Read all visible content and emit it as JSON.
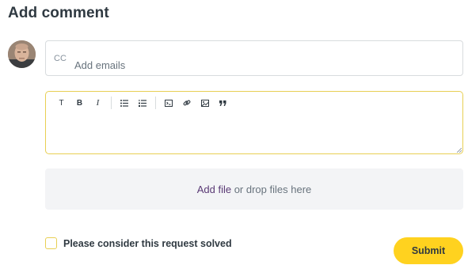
{
  "heading": "Add comment",
  "cc": {
    "label": "CC",
    "placeholder": "Add emails"
  },
  "editor": {
    "toolbar": [
      {
        "name": "text-format",
        "glyph": "T"
      },
      {
        "name": "bold",
        "glyph": "B"
      },
      {
        "name": "italic",
        "glyph": "I"
      },
      {
        "name": "bulleted-list",
        "icon": "bulleted-list-icon"
      },
      {
        "name": "numbered-list",
        "icon": "numbered-list-icon"
      },
      {
        "name": "code-block",
        "icon": "code-block-icon"
      },
      {
        "name": "link",
        "icon": "link-icon"
      },
      {
        "name": "image",
        "icon": "image-icon"
      },
      {
        "name": "quote",
        "icon": "quote-icon"
      }
    ],
    "value": ""
  },
  "attachments": {
    "link_text": "Add file",
    "rest_text": " or drop files here"
  },
  "solved": {
    "label": "Please consider this request solved",
    "checked": false
  },
  "submit_label": "Submit",
  "colors": {
    "accent": "#ffd21f",
    "focus_border": "#e8cf53",
    "link": "#5a3a75",
    "dropzone_bg": "#f3f4f6"
  }
}
